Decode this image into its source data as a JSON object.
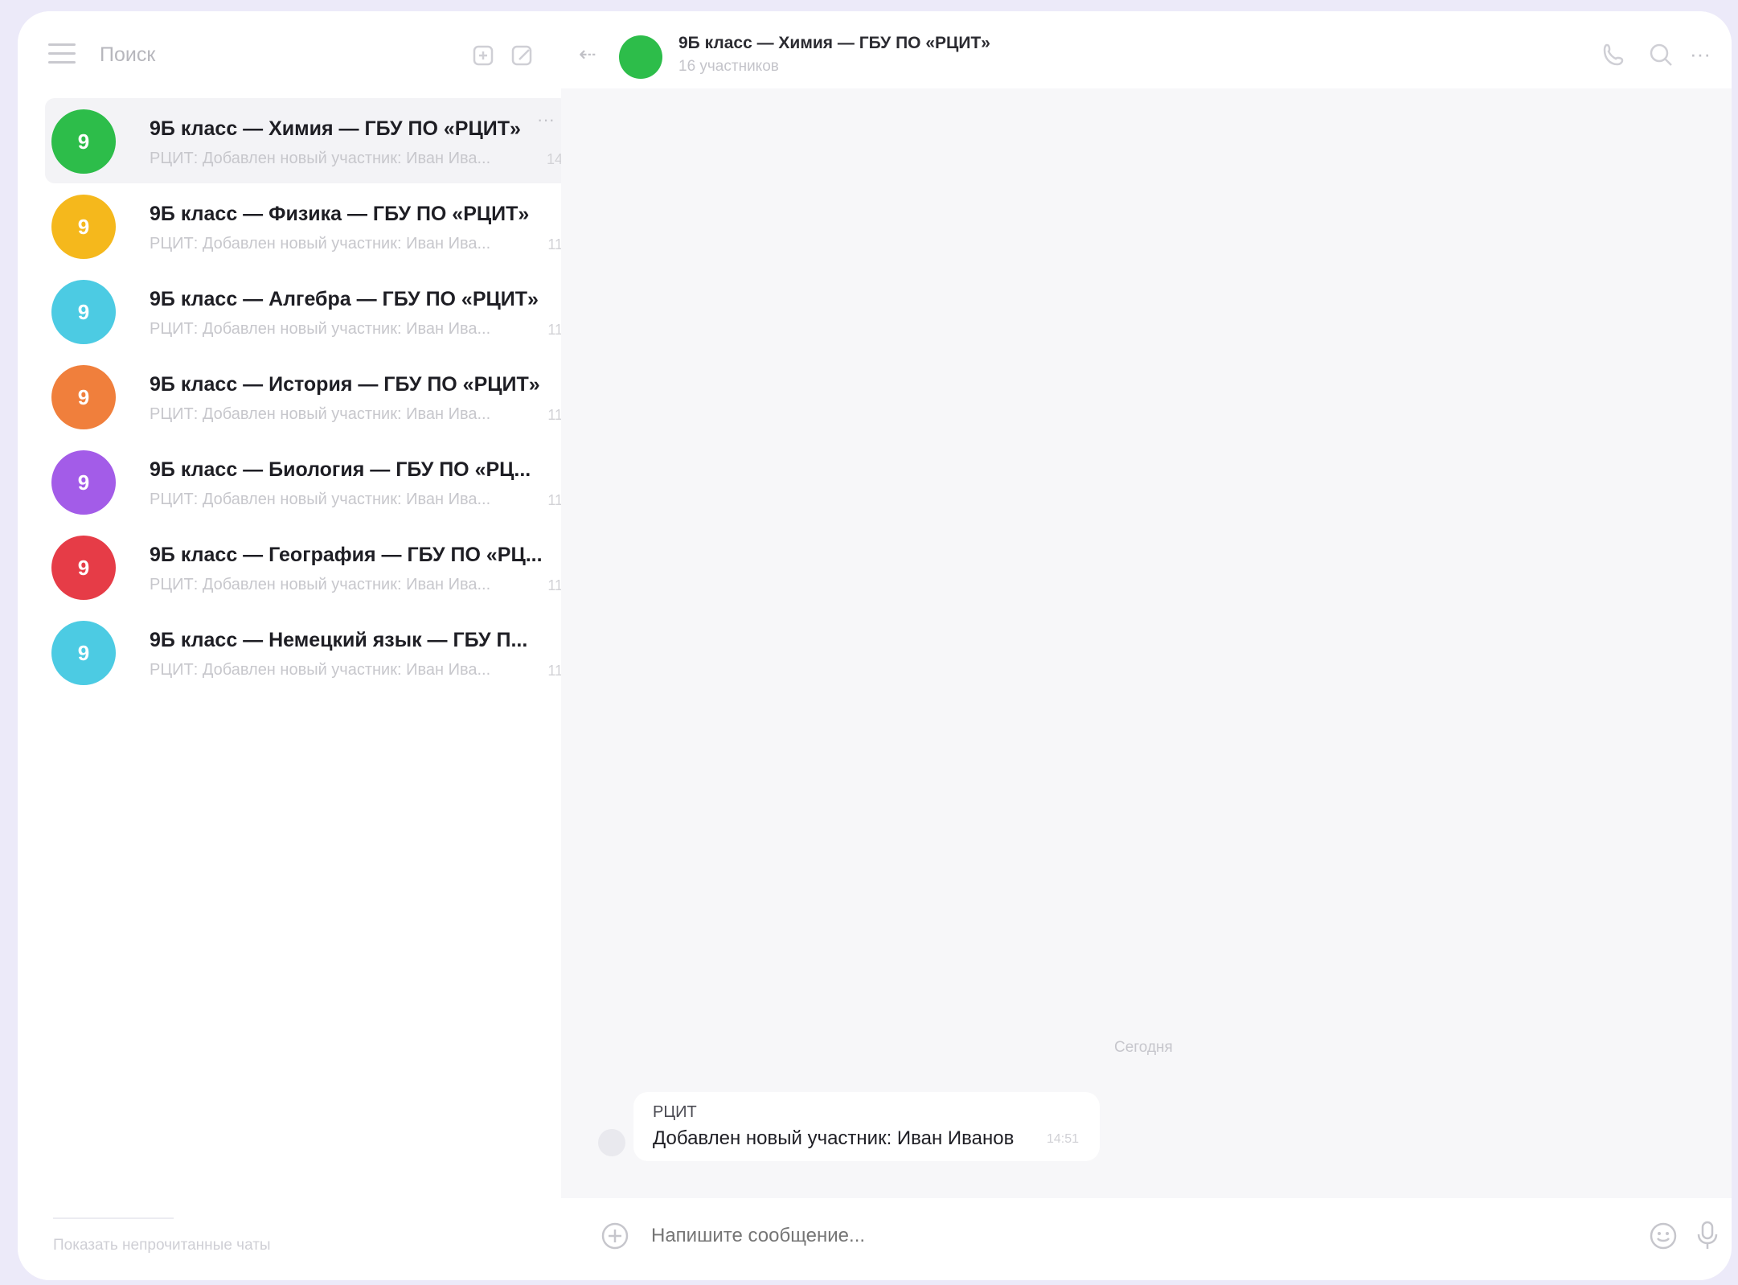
{
  "sidebar": {
    "search_placeholder": "Поиск",
    "chats": [
      {
        "title": "9Б класс — Химия — ГБУ ПО «РЦИТ»",
        "preview": "РЦИТ: Добавлен новый участник: Иван Ива...",
        "time": "14",
        "avatar_letter": "9",
        "color": "#2dbd4a"
      },
      {
        "title": "9Б класс — Физика — ГБУ ПО «РЦИТ»",
        "preview": "РЦИТ: Добавлен новый участник: Иван Ива...",
        "time": "11",
        "avatar_letter": "9",
        "color": "#f5b81c"
      },
      {
        "title": "9Б класс — Алгебра — ГБУ ПО «РЦИТ»",
        "preview": "РЦИТ: Добавлен новый участник: Иван Ива...",
        "time": "11",
        "avatar_letter": "9",
        "color": "#4ccbe3"
      },
      {
        "title": "9Б класс — История — ГБУ ПО «РЦИТ»",
        "preview": "РЦИТ: Добавлен новый участник: Иван Ива...",
        "time": "11",
        "avatar_letter": "9",
        "color": "#f07f3c"
      },
      {
        "title": "9Б класс — Биология — ГБУ ПО «РЦ...",
        "preview": "РЦИТ: Добавлен новый участник: Иван Ива...",
        "time": "11",
        "avatar_letter": "9",
        "color": "#a35ce8"
      },
      {
        "title": "9Б класс — География — ГБУ ПО «РЦ...",
        "preview": "РЦИТ: Добавлен новый участник: Иван Ива...",
        "time": "11",
        "avatar_letter": "9",
        "color": "#e63c47"
      },
      {
        "title": "9Б класс — Немецкий язык — ГБУ П...",
        "preview": "РЦИТ: Добавлен новый участник: Иван Ива...",
        "time": "11",
        "avatar_letter": "9",
        "color": "#4ccbe3"
      }
    ],
    "footer": "Показать непрочитанные чаты"
  },
  "header": {
    "title": "9Б класс — Химия — ГБУ ПО «РЦИТ»",
    "subtitle": "16 участников"
  },
  "feed": {
    "date": "Сегодня",
    "message": {
      "author": "РЦИТ",
      "text": "Добавлен новый участник: Иван Иванов",
      "time": "14:51"
    }
  },
  "composer": {
    "placeholder": "Напишите сообщение..."
  }
}
